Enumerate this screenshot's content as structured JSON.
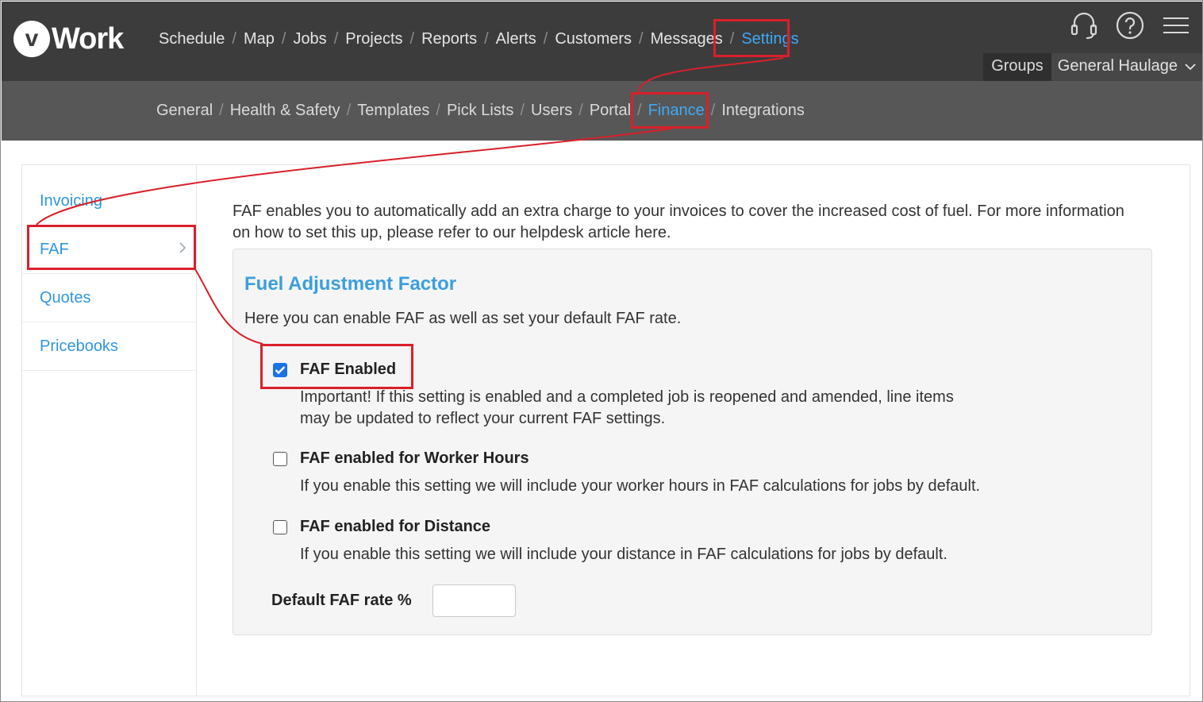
{
  "app": {
    "logo_mark": "v",
    "logo_text": "Work"
  },
  "main_nav": {
    "items": [
      "Schedule",
      "Map",
      "Jobs",
      "Projects",
      "Reports",
      "Alerts",
      "Customers",
      "Messages",
      "Settings"
    ],
    "active": "Settings",
    "separator": "/"
  },
  "top_icons": [
    "headset-icon",
    "help-icon",
    "hamburger-menu-icon"
  ],
  "groups_bar": {
    "groups_label": "Groups",
    "company_label": "General Haulage"
  },
  "sub_nav": {
    "items": [
      "General",
      "Health & Safety",
      "Templates",
      "Pick Lists",
      "Users",
      "Portal",
      "Finance",
      "Integrations"
    ],
    "active": "Finance",
    "separator": "/"
  },
  "sidebar": {
    "items": [
      {
        "label": "Invoicing"
      },
      {
        "label": "FAF"
      },
      {
        "label": "Quotes"
      },
      {
        "label": "Pricebooks"
      }
    ],
    "active": "FAF"
  },
  "intro_text": "FAF enables you to automatically add an extra charge to your invoices to cover the increased cost of fuel. For more information on how to set this up, please refer to our helpdesk article here.",
  "faf_box": {
    "title": "Fuel Adjustment Factor",
    "description": "Here you can enable FAF as well as set your default FAF rate.",
    "options": [
      {
        "label": "FAF Enabled",
        "checked": true,
        "help": "Important! If this setting is enabled and a completed job is reopened and amended, line items may be updated to reflect your current FAF settings."
      },
      {
        "label": "FAF enabled for Worker Hours",
        "checked": false,
        "help": "If you enable this setting we will include your worker hours in FAF calculations for jobs by default."
      },
      {
        "label": "FAF enabled for Distance",
        "checked": false,
        "help": "If you enable this setting we will include your distance in FAF calculations for jobs by default."
      }
    ],
    "rate_label": "Default FAF rate %",
    "rate_value": ""
  },
  "colors": {
    "topbar": "#3c3c3c",
    "subbar": "#575757",
    "accent": "#3fa9f5",
    "annotation": "#d9202a"
  }
}
